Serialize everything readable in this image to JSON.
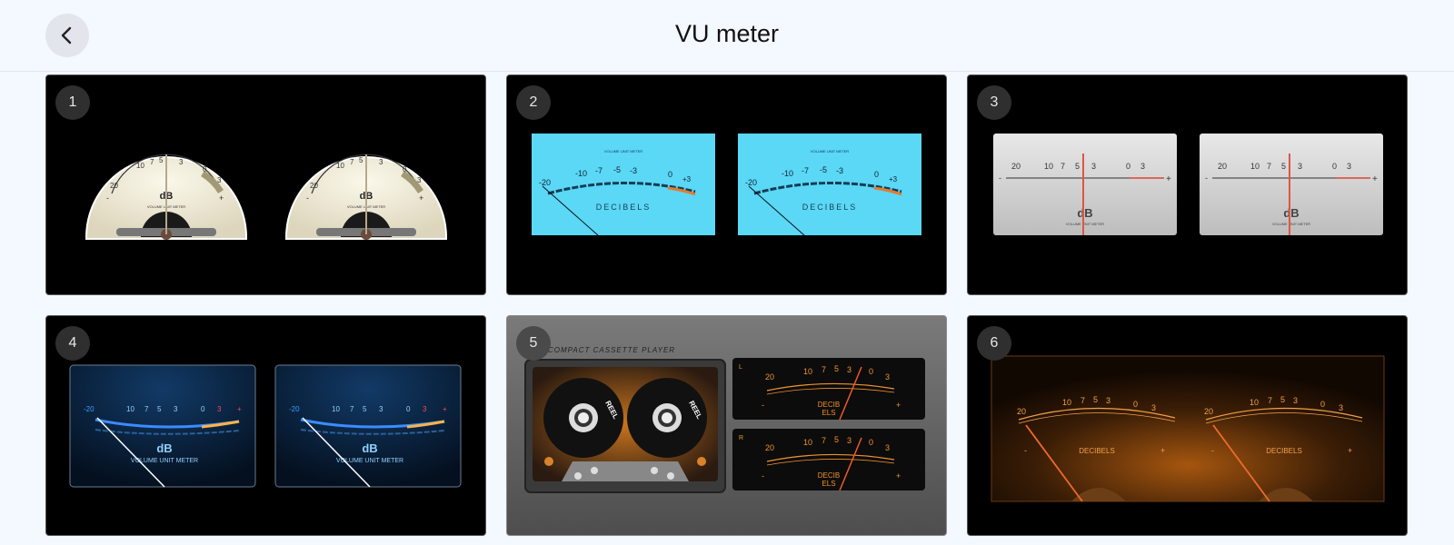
{
  "header": {
    "title": "VU meter",
    "back_icon": "chevron-left-icon"
  },
  "cards": [
    {
      "number": "1",
      "scale": [
        "20",
        "10",
        "7",
        "5",
        "3",
        "0",
        "3",
        "-",
        "+"
      ],
      "unit": "dB",
      "caption": "VOLUME UNIT METER"
    },
    {
      "number": "2",
      "scale": [
        "-20",
        "-10",
        "-7",
        "-5",
        "-3",
        "0",
        "+3"
      ],
      "unit": "DECIBELS",
      "caption": "VOLUME UNIT METER",
      "color": "#5ad8f6"
    },
    {
      "number": "3",
      "scale": [
        "20",
        "10",
        "7",
        "5",
        "3",
        "0",
        "3",
        "-",
        "+"
      ],
      "unit": "dB",
      "caption": "VOLUME UNIT METER"
    },
    {
      "number": "4",
      "scale": [
        "-20",
        "10",
        "7",
        "5",
        "3",
        "0",
        "3",
        "+"
      ],
      "unit": "dB",
      "caption": "VOLUME UNIT METER"
    },
    {
      "number": "5",
      "label": "COMPACT CASSETTE PLAYER",
      "reel": "REEL",
      "channels": [
        "L",
        "R"
      ],
      "scale": [
        "20",
        "10",
        "7",
        "5",
        "3",
        "0",
        "3",
        "-",
        "+"
      ],
      "unit_top": "DECIB",
      "unit_bottom": "ELS"
    },
    {
      "number": "6",
      "scale": [
        "20",
        "10",
        "7",
        "5",
        "3",
        "0",
        "3",
        "-",
        "+"
      ],
      "unit": "DECIBELS"
    }
  ]
}
